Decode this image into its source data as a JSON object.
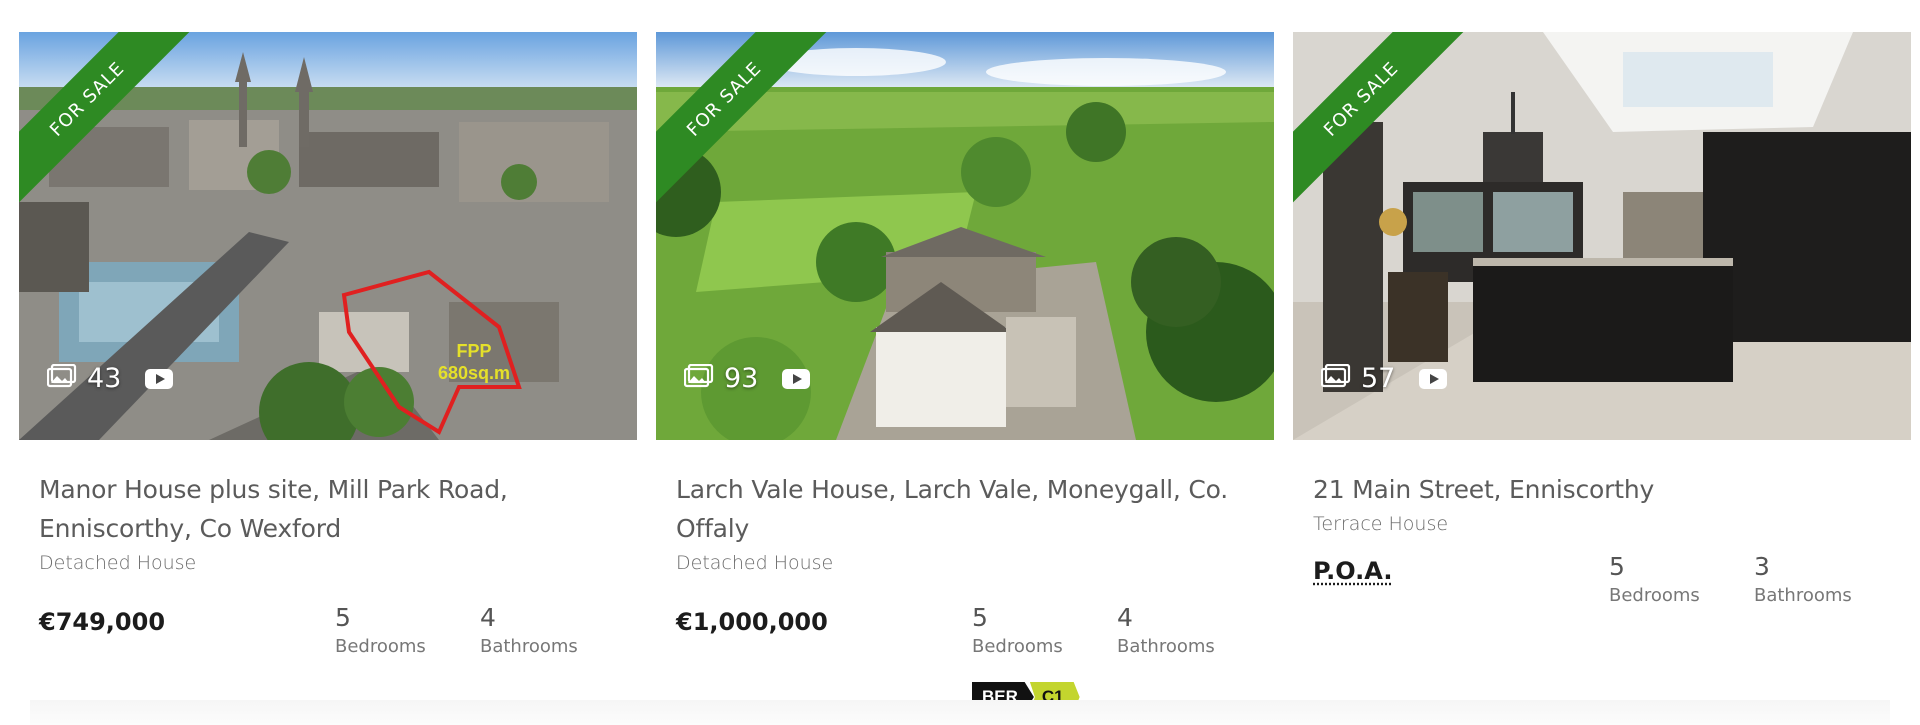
{
  "listings": [
    {
      "status": "FOR SALE",
      "photo_count": "43",
      "overlay_text": [
        "FPP",
        "680sq.m"
      ],
      "title": "Manor House plus site, Mill Park Road, Enniscorthy, Co Wexford",
      "property_type": "Detached House",
      "price": "€749,000",
      "bedrooms": "5",
      "bedrooms_label": "Bedrooms",
      "bathrooms": "4",
      "bathrooms_label": "Bathrooms",
      "photo_icon": "gallery-icon",
      "video_icon": "youtube-icon"
    },
    {
      "status": "FOR SALE",
      "photo_count": "93",
      "title": "Larch Vale House, Larch Vale, Moneygall, Co. Offaly",
      "property_type": "Detached House",
      "price": "€1,000,000",
      "bedrooms": "5",
      "bedrooms_label": "Bedrooms",
      "bathrooms": "4",
      "bathrooms_label": "Bathrooms",
      "ber_label": "BER",
      "ber_rating": "C1",
      "photo_icon": "gallery-icon",
      "video_icon": "youtube-icon"
    },
    {
      "status": "FOR SALE",
      "photo_count": "57",
      "title": "21 Main Street, Enniscorthy",
      "property_type": "Terrace House",
      "price": "P.O.A.",
      "bedrooms": "5",
      "bedrooms_label": "Bedrooms",
      "bathrooms": "3",
      "bathrooms_label": "Bathrooms",
      "photo_icon": "gallery-icon",
      "video_icon": "youtube-icon"
    }
  ],
  "colors": {
    "ribbon": "#2e8a23",
    "price": "#1c1c1c",
    "ber_rating": "#c3d52e"
  }
}
